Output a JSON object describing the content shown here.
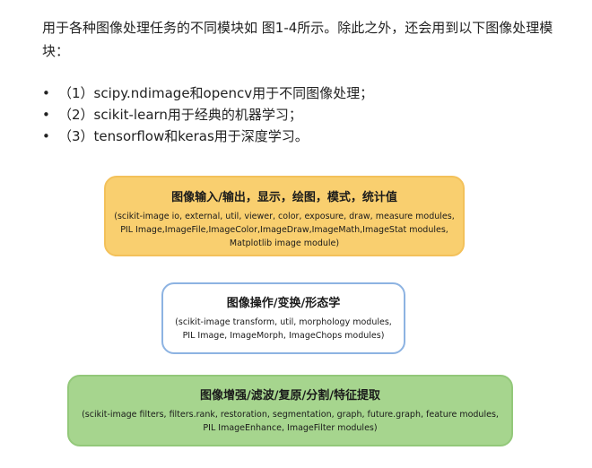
{
  "intro": "用于各种图像处理任务的不同模块如 图1-4所示。除此之外，还会用到以下图像处理模块：",
  "bullets": [
    "（1）scipy.ndimage和opencv用于不同图像处理；",
    "（2）scikit-learn用于经典的机器学习；",
    "（3）tensorflow和keras用于深度学习。"
  ],
  "bullet_symbol": "•",
  "figure": {
    "boxes": [
      {
        "title": "图像输入/输出，显示，绘图，模式，统计值",
        "lines": [
          "(scikit-image io, external, util, viewer, color, exposure, draw, measure modules,",
          "PIL Image,ImageFile,ImageColor,ImageDraw,ImageMath,ImageStat modules,",
          "Matplotlib image module)"
        ],
        "fill_color": "#f9cf6f"
      },
      {
        "title": "图像操作/变换/形态学",
        "lines": [
          "(scikit-image transform, util, morphology modules,",
          "PIL Image, ImageMorph, ImageChops modules)"
        ],
        "fill_color": "#ffffff",
        "border_color": "#8db3e2"
      },
      {
        "title": "图像增强/滤波/复原/分割/特征提取",
        "lines": [
          "(scikit-image filters, filters.rank, restoration, segmentation, graph, future.graph, feature modules,",
          "PIL ImageEnhance, ImageFilter modules)"
        ],
        "fill_color": "#a6d58e"
      }
    ]
  }
}
